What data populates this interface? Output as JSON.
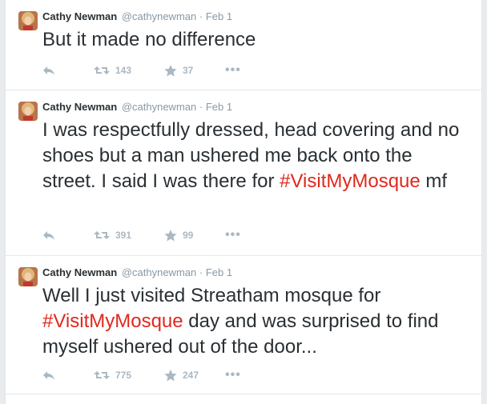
{
  "accent_color": "#e0281d",
  "muted_color": "#8899a6",
  "tweets": [
    {
      "name": "Cathy Newman",
      "handle": "@cathynewman",
      "separator": "·",
      "time": "Feb 1",
      "text_plain": "But it made no difference",
      "retweets": "143",
      "favorites": "37",
      "more_icon": "•••"
    },
    {
      "name": "Cathy Newman",
      "handle": "@cathynewman",
      "separator": "·",
      "time": "Feb 1",
      "text_before": "I was respectfully dressed, head covering and no shoes but a man ushered me back onto the street. I said I was there for ",
      "hashtag": "#VisitMyMosque",
      "text_after": " mf",
      "retweets": "391",
      "favorites": "99",
      "more_icon": "•••"
    },
    {
      "name": "Cathy Newman",
      "handle": "@cathynewman",
      "separator": "·",
      "time": "Feb 1",
      "text_before": "Well I just visited Streatham mosque for ",
      "hashtag": "#VisitMyMosque",
      "text_after": " day and was surprised to find myself ushered out of the door...",
      "retweets": "775",
      "favorites": "247",
      "more_icon": "•••"
    }
  ]
}
